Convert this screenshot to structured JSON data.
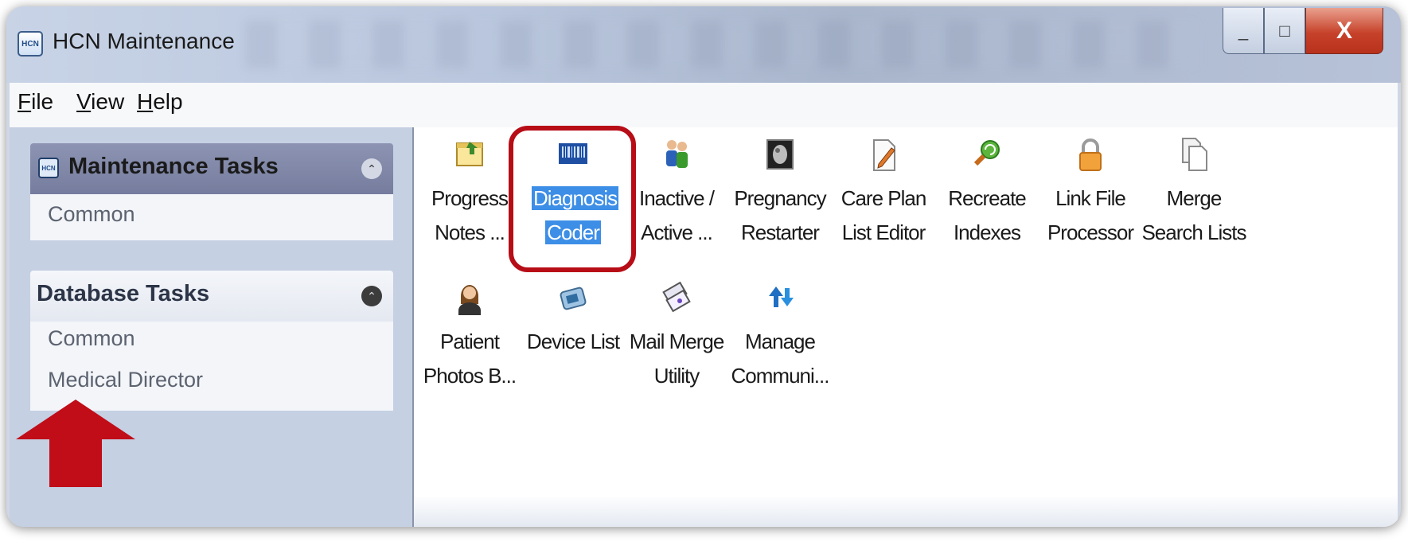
{
  "window": {
    "title": "HCN Maintenance",
    "icon_text": "HCN",
    "controls": {
      "minimize": "_",
      "maximize": "□",
      "close": "X"
    }
  },
  "menu": [
    {
      "label": "File",
      "accel": "F"
    },
    {
      "label": "View",
      "accel": "V"
    },
    {
      "label": "Help",
      "accel": "H"
    }
  ],
  "sidebar": {
    "maintenance": {
      "title": "Maintenance Tasks",
      "icon_text": "HCN",
      "items": [
        "Common"
      ]
    },
    "database": {
      "title": "Database Tasks",
      "items": [
        "Common",
        "Medical Director"
      ]
    }
  },
  "tiles": [
    {
      "line1": "Progress",
      "line2": "Notes ...",
      "icon": "notes-icon"
    },
    {
      "line1": "Diagnosis",
      "line2": "Coder",
      "icon": "barcode-icon",
      "selected": true
    },
    {
      "line1": "Inactive /",
      "line2": "Active ...",
      "icon": "people-icon"
    },
    {
      "line1": "Pregnancy",
      "line2": "Restarter",
      "icon": "ultrasound-icon"
    },
    {
      "line1": "Care Plan",
      "line2": "List Editor",
      "icon": "edit-document-icon"
    },
    {
      "line1": "Recreate",
      "line2": "Indexes",
      "icon": "refresh-search-icon"
    },
    {
      "line1": "Link File",
      "line2": "Processor",
      "icon": "lock-icon"
    },
    {
      "line1": "Merge",
      "line2": "Search Lists",
      "icon": "copy-documents-icon"
    },
    {
      "line1": "Patient",
      "line2": "Photos B...",
      "icon": "person-photo-icon"
    },
    {
      "line1": "Device List",
      "line2": "",
      "icon": "device-icon"
    },
    {
      "line1": "Mail Merge",
      "line2": "Utility",
      "icon": "mail-merge-icon"
    },
    {
      "line1": "Manage",
      "line2": "Communi...",
      "icon": "sync-arrows-icon"
    }
  ],
  "colors": {
    "highlight_border": "#b70d17",
    "selection": "#3d8ee6",
    "arrow": "#c00d18"
  }
}
